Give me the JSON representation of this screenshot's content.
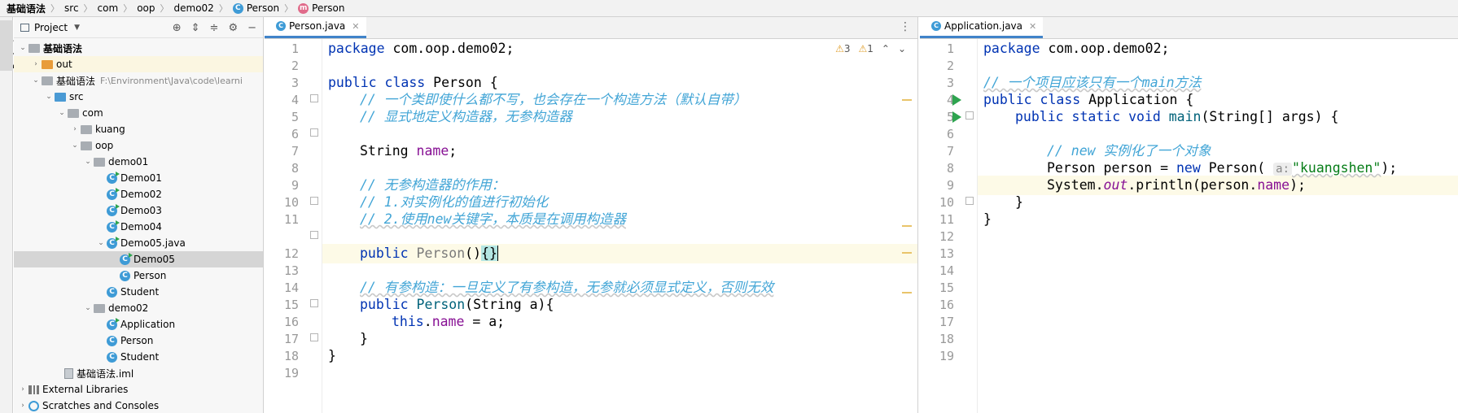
{
  "breadcrumb": {
    "items": [
      "基础语法",
      "src",
      "com",
      "oop",
      "demo02",
      "Person",
      "Person"
    ]
  },
  "toolstrip": {
    "project_tab": "Project"
  },
  "project": {
    "title": "Project",
    "path_hint": "F:\\Environment\\Java\\code\\learni",
    "tree": [
      {
        "label": "基础语法",
        "bold": true
      },
      {
        "label": "out"
      },
      {
        "label": "基础语法"
      },
      {
        "label": "src"
      },
      {
        "label": "com"
      },
      {
        "label": "kuang"
      },
      {
        "label": "oop"
      },
      {
        "label": "demo01"
      },
      {
        "label": "Demo01"
      },
      {
        "label": "Demo02"
      },
      {
        "label": "Demo03"
      },
      {
        "label": "Demo04"
      },
      {
        "label": "Demo05.java"
      },
      {
        "label": "Demo05"
      },
      {
        "label": "Person"
      },
      {
        "label": "Student"
      },
      {
        "label": "demo02"
      },
      {
        "label": "Application"
      },
      {
        "label": "Person"
      },
      {
        "label": "Student"
      },
      {
        "label": "基础语法.iml"
      },
      {
        "label": "External Libraries"
      },
      {
        "label": "Scratches and Consoles"
      }
    ]
  },
  "editor_left": {
    "tab_label": "Person.java",
    "inspection": {
      "warnings": "3",
      "weak_warnings": "1"
    },
    "line_numbers": [
      "1",
      "2",
      "3",
      "4",
      "5",
      "6",
      "7",
      "8",
      "9",
      "10",
      "11",
      "12",
      "13",
      "14",
      "15",
      "16",
      "17",
      "18",
      "19"
    ],
    "code": {
      "l1_kw": "package",
      "l1_rest": " com.oop.demo02;",
      "l3_kw": "public class",
      "l3_rest": " Person {",
      "l4": "// 一个类即使什么都不写，也会存在一个构造方法（默认自带）",
      "l5": "// 显式地定义构造器，无参构造器",
      "l7_type": "String ",
      "l7_field": "name",
      "l7_end": ";",
      "l9": "// 无参构造器的作用：",
      "l10": "// 1.对实例化的值进行初始化",
      "l11": "// 2.使用new关键字，本质是在调用构造器",
      "l12_kw": "public ",
      "l12_name": "Person",
      "l12_paren": "()",
      "l12_brace": "{}",
      "l14": "// 有参构造：一旦定义了有参构造，无参就必须显式定义，否则无效",
      "l15_kw": "public ",
      "l15_name": "Person",
      "l15_rest": "(String a){",
      "l16_kw": "this",
      "l16_dot": ".",
      "l16_field": "name",
      "l16_rest": " = a;",
      "l17": "}",
      "l18": "}"
    }
  },
  "editor_right": {
    "tab_label": "Application.java",
    "line_numbers": [
      "1",
      "2",
      "3",
      "4",
      "5",
      "6",
      "7",
      "8",
      "9",
      "10",
      "11",
      "12",
      "13",
      "14",
      "15",
      "16",
      "17",
      "18",
      "19"
    ],
    "code": {
      "l1_kw": "package",
      "l1_rest": " com.oop.demo02;",
      "l3": "// 一个项目应该只有一个main方法",
      "l4_kw": "public class",
      "l4_rest": " Application {",
      "l5_kw": "public static void ",
      "l5_m": "main",
      "l5_rest": "(String[] args) {",
      "l7": "// new 实例化了一个对象",
      "l8_a": "Person person = ",
      "l8_kw": "new",
      "l8_b": " Person( ",
      "l8_hint": "a:",
      "l8_str": "\"kuangshen\"",
      "l8_end": ");",
      "l9_a": "System.",
      "l9_out": "out",
      "l9_b": ".println(person.",
      "l9_f": "name",
      "l9_end": ");",
      "l10": "}",
      "l11": "}"
    }
  }
}
